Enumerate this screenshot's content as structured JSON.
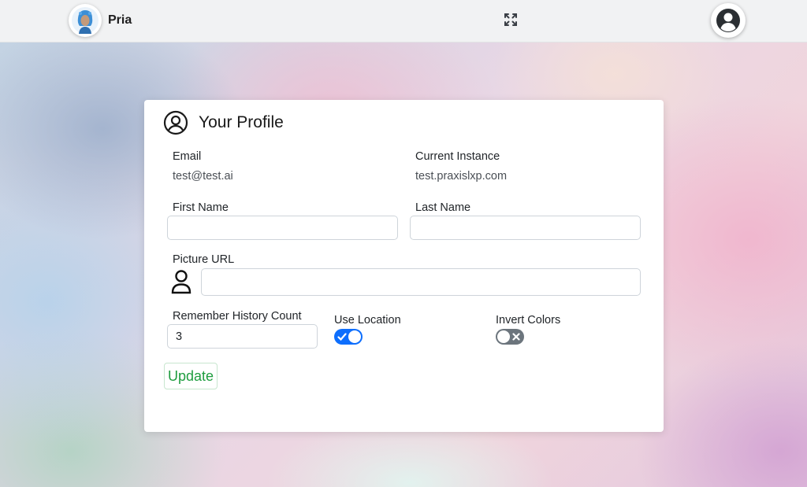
{
  "app": {
    "name": "Pria"
  },
  "colors": {
    "accent": "#0d6efd",
    "success": "#1f9d3f",
    "toggle_off": "#6c757d"
  },
  "icons": {
    "brand": "robot-avatar-icon",
    "expand": "expand-arrows-icon",
    "user": "user-circle-icon",
    "profile": "user-circle-outline-icon",
    "picture": "person-outline-icon"
  },
  "profile": {
    "title": "Your Profile",
    "email_label": "Email",
    "email_value": "test@test.ai",
    "instance_label": "Current Instance",
    "instance_value": "test.praxislxp.com",
    "first_name_label": "First Name",
    "first_name_value": "",
    "last_name_label": "Last Name",
    "last_name_value": "",
    "picture_label": "Picture URL",
    "picture_value": "",
    "history_label": "Remember History Count",
    "history_value": "3",
    "location_label": "Use Location",
    "location_enabled": true,
    "invert_label": "Invert Colors",
    "invert_enabled": false,
    "update_label": "Update"
  }
}
